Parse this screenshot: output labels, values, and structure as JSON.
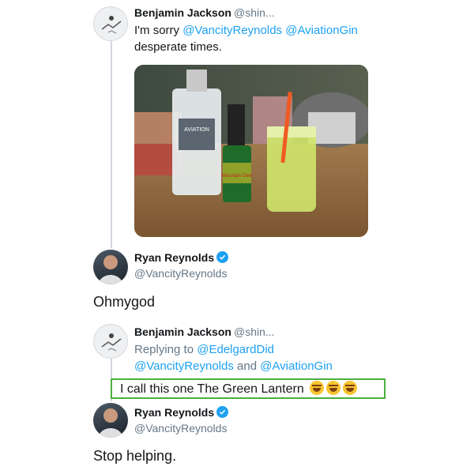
{
  "tweet1": {
    "name": "Benjamin Jackson",
    "handle": "@shin...",
    "text_prefix": "I'm sorry ",
    "mention1": "@VancityReynolds",
    "mention2": "@AviationGin",
    "line2": "desperate times."
  },
  "tweet2": {
    "name": "Ryan Reynolds",
    "handle": "@VancityReynolds",
    "text": "Ohmygod",
    "verified": true
  },
  "tweet3": {
    "name": "Benjamin Jackson",
    "handle": "@shin...",
    "reply_prefix": "Replying to ",
    "reply_mention1": "@EdelgardDid",
    "reply_mention2": "@VancityReynolds",
    "reply_and": " and ",
    "reply_mention3": "@AviationGin",
    "text": "I call this one The Green Lantern"
  },
  "tweet4": {
    "name": "Ryan Reynolds",
    "handle": "@VancityReynolds",
    "text": "Stop helping.",
    "verified": true
  },
  "photo": {
    "bottle_label": "AVIATION",
    "can_label": "Mountain Dew"
  },
  "colors": {
    "mention": "#1da1f2",
    "highlight_border": "#4caf3f",
    "verified": "#1da1f2"
  }
}
